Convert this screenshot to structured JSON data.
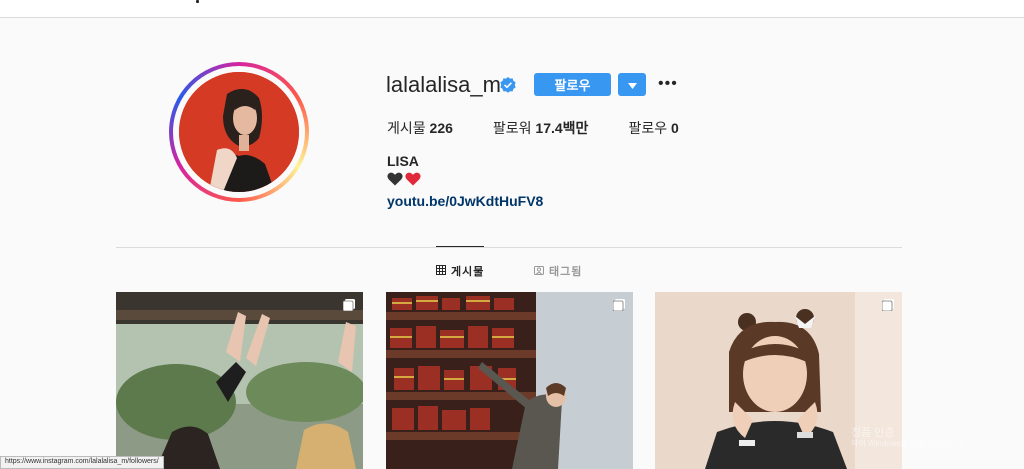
{
  "profile": {
    "username": "lalalalisa_m",
    "follow_label": "팔로우",
    "stats": [
      {
        "label": "게시물",
        "value": "226"
      },
      {
        "label": "팔로워",
        "value": "17.4백만"
      },
      {
        "label": "팔로우",
        "value": "0"
      }
    ],
    "bio_name": "LISA",
    "bio_link": "youtu.be/0JwKdtHuFV8"
  },
  "tabs": [
    {
      "label": "게시물",
      "icon": "grid-icon",
      "active": true
    },
    {
      "label": "태그됨",
      "icon": "tagged-icon",
      "active": false
    }
  ],
  "status_bar": {
    "url": "https://www.instagram.com/lalalalisa_m/followers/"
  },
  "watermark": {
    "line1": "정품 인증",
    "line2": "하여 Windows를 정품 인증합니다."
  },
  "colors": {
    "accent": "#3897f0",
    "link": "#003569",
    "verified": "#3897f0"
  }
}
